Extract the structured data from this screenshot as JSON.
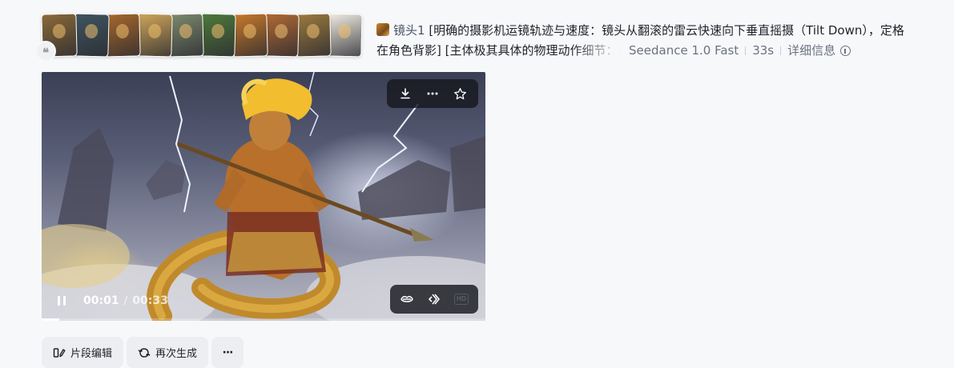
{
  "reference_images": {
    "thumbnails": [
      {
        "name": "ref-thumb-1",
        "tone": "#8a6a3a"
      },
      {
        "name": "ref-thumb-2",
        "tone": "#3f5560"
      },
      {
        "name": "ref-thumb-3",
        "tone": "#a8682c"
      },
      {
        "name": "ref-thumb-4",
        "tone": "#cfa65a"
      },
      {
        "name": "ref-thumb-5",
        "tone": "#7d8a6e"
      },
      {
        "name": "ref-thumb-6",
        "tone": "#4e7a3c"
      },
      {
        "name": "ref-thumb-7",
        "tone": "#c87a2a"
      },
      {
        "name": "ref-thumb-8",
        "tone": "#b06a34"
      },
      {
        "name": "ref-thumb-9",
        "tone": "#9c7a3e"
      },
      {
        "name": "ref-thumb-10",
        "tone": "#f2ede4"
      }
    ],
    "quote_glyph": "❝"
  },
  "prompt": {
    "shot_label": "镜头1",
    "line1": "[明确的摄影机运镜轨迹与速度：镜头从翻滚的雷云快速向下垂直摇摄（Tilt Down），定格",
    "line2": "在角色背影] [主体极其具体的物理动作细节：龙尾具有真实的"
  },
  "meta": {
    "model": "Seedance 1.0 Fast",
    "duration": "33s",
    "details_label": "详细信息"
  },
  "video": {
    "current_time": "00:01",
    "time_separator": "/",
    "total_time": "00:33",
    "progress_fraction": 0.04,
    "top_actions": [
      "download-icon",
      "more-dots-icon",
      "star-icon"
    ],
    "bottom_actions": [
      "lip-sync-icon",
      "diamond-arrows-icon",
      "hd-badge-icon"
    ],
    "hd_badge": "HD"
  },
  "actions": {
    "edit_label": "片段编辑",
    "regenerate_label": "再次生成",
    "more_label": "···"
  },
  "colors": {
    "page_background": "#f7f8fa",
    "button_background": "#eceef1",
    "overlay_dark": "#16181e",
    "text_primary": "#1f2329",
    "text_secondary": "#6b7280"
  }
}
